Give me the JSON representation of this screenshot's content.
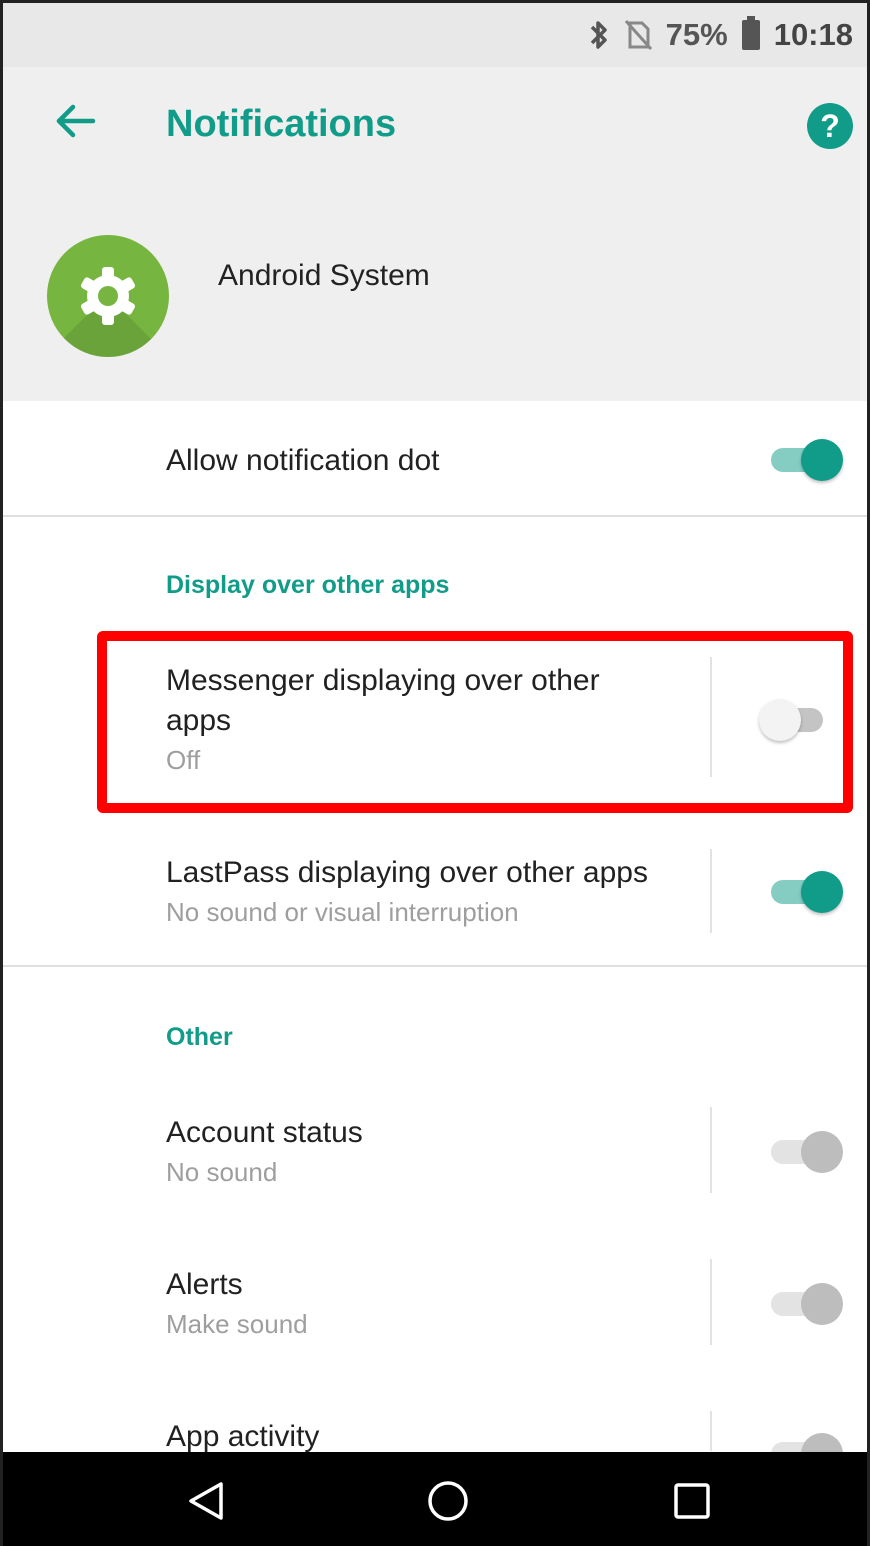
{
  "status_bar": {
    "bluetooth_icon": "bluetooth-icon",
    "no_sim_icon": "no-sim-icon",
    "battery_percent": "75%",
    "battery_icon": "battery-icon",
    "time": "10:18"
  },
  "header": {
    "title": "Notifications",
    "back_icon": "arrow-left-icon",
    "help_icon": "help-circle-icon",
    "help_glyph": "?",
    "app_icon": "gear-icon",
    "app_name": "Android System",
    "accent_color": "#119c89",
    "app_icon_color": "#76b640"
  },
  "settings": {
    "notification_dot": {
      "label": "Allow notification dot",
      "enabled": true
    }
  },
  "sections": [
    {
      "label": "Display over other apps",
      "items": [
        {
          "title": "Messenger displaying over other apps",
          "subtitle": "Off",
          "enabled": false,
          "highlighted": true
        },
        {
          "title": "LastPass displaying over other apps",
          "subtitle": "No sound or visual interruption",
          "enabled": true
        }
      ]
    },
    {
      "label": "Other",
      "items": [
        {
          "title": "Account status",
          "subtitle": "No sound",
          "enabled": true,
          "disabled": true
        },
        {
          "title": "Alerts",
          "subtitle": "Make sound",
          "enabled": true,
          "disabled": true
        },
        {
          "title": "App activity",
          "subtitle": "",
          "enabled": true,
          "disabled": true
        }
      ]
    }
  ],
  "nav_bar": {
    "back": "nav-back-icon",
    "home": "nav-home-icon",
    "recents": "nav-recents-icon"
  }
}
